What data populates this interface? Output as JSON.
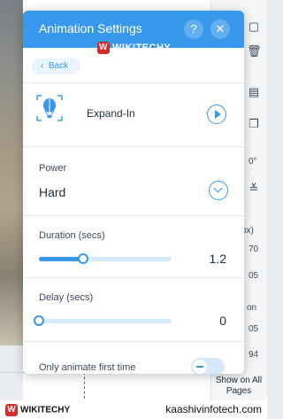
{
  "panel": {
    "title": "Animation Settings",
    "help_icon": "question-mark-icon",
    "close_icon": "close-icon"
  },
  "back": {
    "label": "Back"
  },
  "animation": {
    "name": "Expand-In",
    "icon": "hot-air-balloon-icon"
  },
  "power": {
    "label": "Power",
    "value": "Hard"
  },
  "duration": {
    "label": "Duration (secs)",
    "value": "1.2",
    "fraction": 0.33
  },
  "delay": {
    "label": "Delay (secs)",
    "value": "0",
    "fraction": 0.0
  },
  "only_first": {
    "label": "Only animate first time",
    "on": false
  },
  "right_bar": {
    "degree": "0°",
    "px_label": "px)",
    "num1": "70",
    "num2": "05",
    "on_label": "on",
    "num3": "05",
    "num4": "94",
    "show_all": "Show on All Pages"
  },
  "watermark": {
    "logo": "WIKITECHY",
    "site": "kaashivinfotech.com"
  },
  "colors": {
    "accent": "#3899ec"
  }
}
